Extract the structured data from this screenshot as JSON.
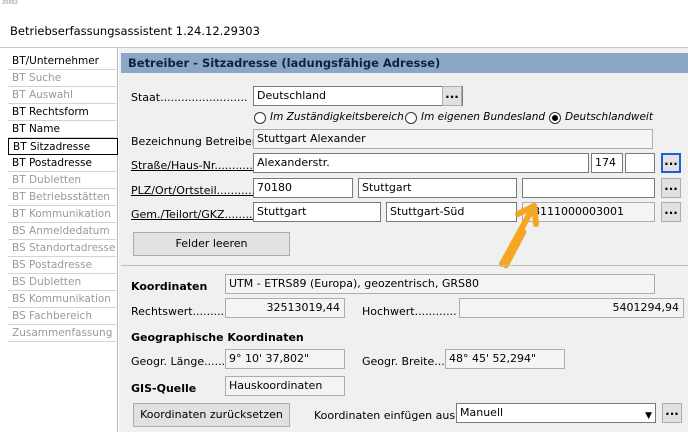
{
  "window": {
    "stub": "20002",
    "title": "Betriebserfassungsassistent 1.24.12.29303"
  },
  "sidebar": {
    "items": [
      {
        "label": "BT/Unternehmer",
        "state": "normal"
      },
      {
        "label": "BT Suche",
        "state": "disabled"
      },
      {
        "label": "BT Auswahl",
        "state": "disabled"
      },
      {
        "label": "BT Rechtsform",
        "state": "normal"
      },
      {
        "label": "BT Name",
        "state": "normal"
      },
      {
        "label": "BT Sitzadresse",
        "state": "selected"
      },
      {
        "label": "BT Postadresse",
        "state": "normal"
      },
      {
        "label": "BT Dubletten",
        "state": "disabled"
      },
      {
        "label": "BT Betriebsstätten",
        "state": "disabled"
      },
      {
        "label": "BT Kommunikation",
        "state": "disabled"
      },
      {
        "label": "BS Anmeldedatum",
        "state": "disabled"
      },
      {
        "label": "BS Standortadresse",
        "state": "disabled"
      },
      {
        "label": "BS Postadresse",
        "state": "disabled"
      },
      {
        "label": "BS Dubletten",
        "state": "disabled"
      },
      {
        "label": "BS Kommunikation",
        "state": "disabled"
      },
      {
        "label": "BS Fachbereich",
        "state": "disabled"
      },
      {
        "label": "Zusammenfassung",
        "state": "disabled"
      }
    ]
  },
  "section": {
    "title": "Betreiber - Sitzadresse (ladungsfähige Adresse)"
  },
  "staat": {
    "label": "Staat.........................",
    "value": "Deutschland",
    "dots": "..."
  },
  "scope": {
    "options": [
      {
        "label": "Im Zuständigkeitsbereich",
        "selected": false
      },
      {
        "label": "Im eigenen Bundesland",
        "selected": false
      },
      {
        "label": "Deutschlandweit",
        "selected": true
      }
    ]
  },
  "bezeichnung": {
    "label": "Bezeichnung Betreiber.....",
    "value": "Stuttgart Alexander"
  },
  "strasse": {
    "label": "Straße/Haus-Nr...........",
    "value": "Alexanderstr.",
    "number": "174",
    "addition": "",
    "dots": "..."
  },
  "plz": {
    "label": "PLZ/Ort/Ortsteil...........",
    "plz": "70180",
    "ort": "Stuttgart",
    "ortsteil": "",
    "extra": "",
    "dots": "..."
  },
  "gem": {
    "label": "Gem./Teilort/GKZ...........",
    "gemeinde": "Stuttgart",
    "teilort": "Stuttgart-Süd",
    "gkz": "08111000003001",
    "dots": "..."
  },
  "clear_button": "Felder leeren",
  "koordinaten": {
    "label": "Koordinaten",
    "system": "UTM - ETRS89 (Europa), geozentrisch, GRS80",
    "rechtswert_label": "Rechtswert.........",
    "rechtswert": "32513019,44",
    "hochwert_label": "Hochwert............",
    "hochwert": "5401294,94"
  },
  "geo": {
    "label": "Geographische Koordinaten",
    "laenge_label": "Geogr. Länge........",
    "laenge": "9° 10' 37,802\"",
    "breite_label": "Geogr. Breite........",
    "breite": "48° 45' 52,294\""
  },
  "gis": {
    "label": "GIS-Quelle",
    "value": "Hauskoordinaten"
  },
  "bottom": {
    "reset_button": "Koordinaten zurücksetzen",
    "insert_label": "Koordinaten einfügen aus......",
    "insert_value": "Manuell",
    "dropdown_arrow": "▼",
    "dots": "..."
  },
  "colors": {
    "header_bg": "#8aa7c8",
    "focus_border": "#1e5fd8",
    "annotation_arrow": "#f5a623"
  }
}
